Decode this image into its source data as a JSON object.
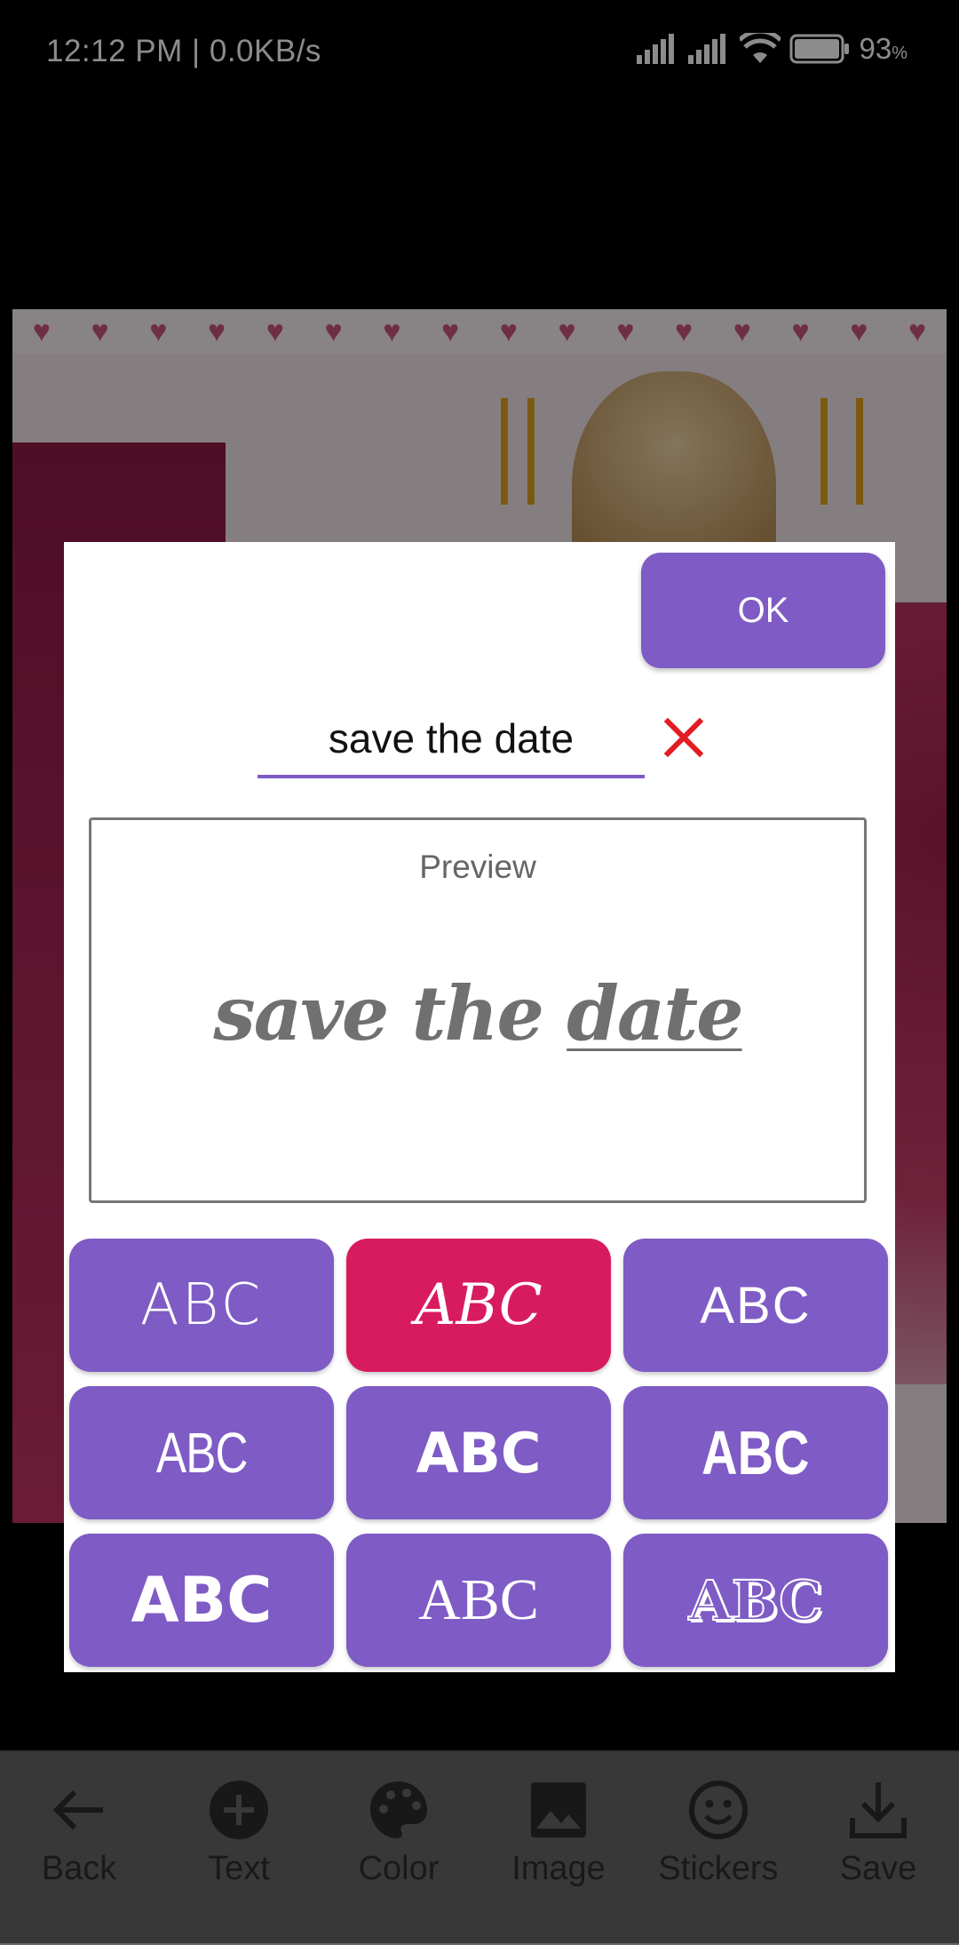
{
  "status_bar": {
    "time_speed": "12:12 PM | 0.0KB/s",
    "battery": "93",
    "battery_unit": "%"
  },
  "dialog": {
    "ok_label": "OK",
    "input_value": "save the date",
    "preview_label": "Preview",
    "preview_text_plain": "save the ",
    "preview_text_underlined": "date",
    "font_samples": [
      "ABC",
      "ABC",
      "ABC",
      "ABC",
      "ABC",
      "ABC",
      "ABC",
      "ABC",
      "ABC"
    ],
    "selected_font_index": 1
  },
  "toolbar": {
    "back": "Back",
    "text": "Text",
    "color": "Color",
    "image": "Image",
    "stickers": "Stickers",
    "save": "Save"
  },
  "colors": {
    "accent": "#7e5bc5",
    "selected": "#d81b5f",
    "clear_icon": "#e31b23",
    "toolbar_bg": "#676767"
  }
}
